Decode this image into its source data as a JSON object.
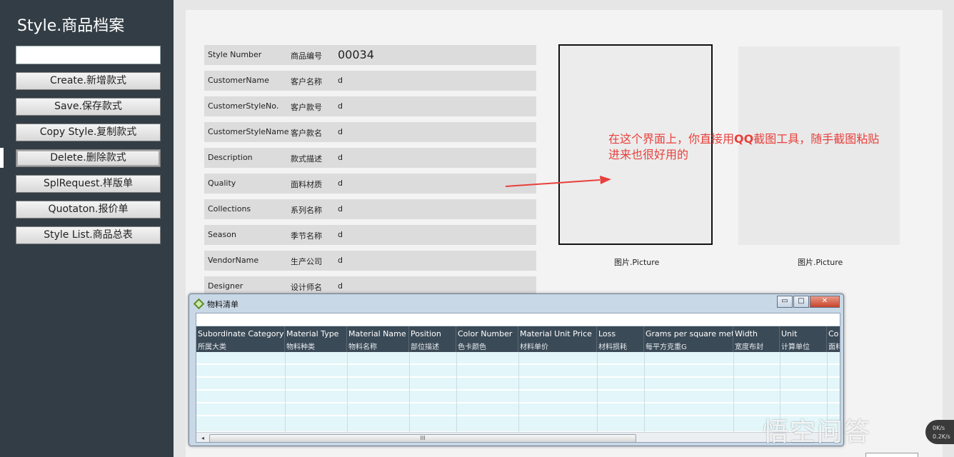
{
  "sidebar": {
    "title": "Style.商品档案",
    "search_value": "",
    "buttons": [
      "Create.新增款式",
      "Save.保存款式",
      "Copy Style.复制款式",
      "Delete.删除款式",
      "SplRequest.样版单",
      "Quotaton.报价单",
      "Style List.商品总表"
    ]
  },
  "form": {
    "rows": [
      {
        "en": "Style Number",
        "cn": "商品编号",
        "value": "00034"
      },
      {
        "en": "CustomerName",
        "cn": "客户名称",
        "value": "d"
      },
      {
        "en": "CustomerStyleNo.",
        "cn": "客户款号",
        "value": "d"
      },
      {
        "en": "CustomerStyleName",
        "cn": "客户款名",
        "value": "d"
      },
      {
        "en": "Description",
        "cn": "款式描述",
        "value": "d"
      },
      {
        "en": "Quality",
        "cn": "面料材质",
        "value": "d"
      },
      {
        "en": "Collections",
        "cn": "系列名称",
        "value": "d"
      },
      {
        "en": "Season",
        "cn": "季节名称",
        "value": "d"
      },
      {
        "en": "VendorName",
        "cn": "生产公司",
        "value": "d"
      },
      {
        "en": "Designer",
        "cn": "设计师名",
        "value": "d"
      }
    ]
  },
  "pictures": {
    "label_1": "图片.Picture",
    "label_2": "图片.Picture"
  },
  "annotation": {
    "line1_a": "在这个界面上，你直接用",
    "line1_hl": "QQ",
    "line1_b": "截图工具，随手截图粘贴",
    "line2": "进来也很好用的"
  },
  "material_window": {
    "title": "物料清单",
    "controls": {
      "minimize": "▭",
      "maximize": "□",
      "close": "✕"
    },
    "columns": [
      {
        "en": "Subordinate Category",
        "cn": "所属大类"
      },
      {
        "en": "Material Type",
        "cn": "物料种类"
      },
      {
        "en": "Material Name",
        "cn": "物料名称"
      },
      {
        "en": "Position",
        "cn": "部位描述"
      },
      {
        "en": "Color Number",
        "cn": "色卡颜色"
      },
      {
        "en": "Material Unit Price",
        "cn": "材料单价"
      },
      {
        "en": "Loss",
        "cn": "材料损耗"
      },
      {
        "en": "Grams per square meter",
        "cn": "每平方克重G"
      },
      {
        "en": "Width",
        "cn": "宽度布封"
      },
      {
        "en": "Unit",
        "cn": "计算单位"
      },
      {
        "en": "Co",
        "cn": "面料"
      }
    ],
    "scroll_left": "◂",
    "scroll_grip": "III"
  },
  "watermark": "悟空问答",
  "speed": {
    "up": "0K/s",
    "down": "0.2K/s"
  },
  "colors": {
    "sidebar_bg": "#333d45",
    "annotation": "#e8403c",
    "grid_header": "#3b4a57",
    "grid_row": "#e3f6f9"
  }
}
